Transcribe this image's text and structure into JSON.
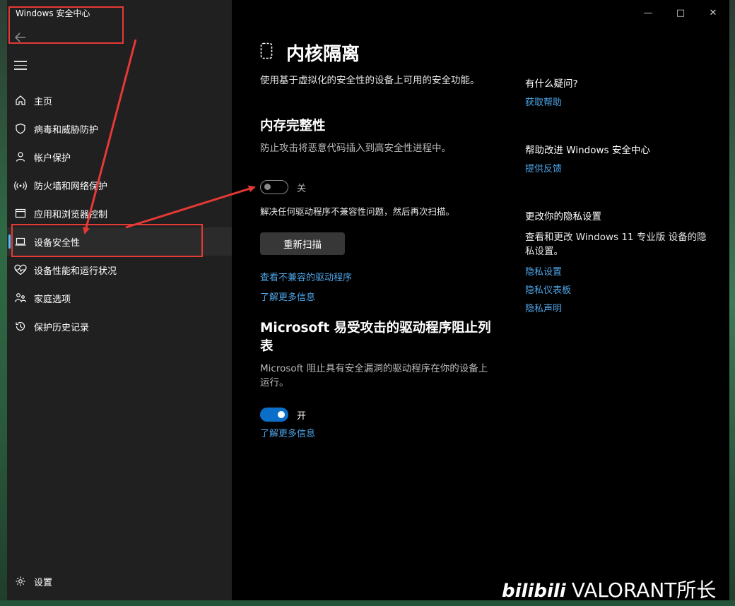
{
  "window": {
    "title": "Windows 安全中心",
    "minimize_glyph": "—",
    "maximize_glyph": "□",
    "close_glyph": "✕"
  },
  "sidebar": {
    "items": [
      {
        "label": "主页",
        "icon": "home-icon"
      },
      {
        "label": "病毒和威胁防护",
        "icon": "shield-icon"
      },
      {
        "label": "帐户保护",
        "icon": "person-icon"
      },
      {
        "label": "防火墙和网络保护",
        "icon": "wifi-icon"
      },
      {
        "label": "应用和浏览器控制",
        "icon": "app-window-icon"
      },
      {
        "label": "设备安全性",
        "icon": "laptop-icon",
        "active": true
      },
      {
        "label": "设备性能和运行状况",
        "icon": "heart-pulse-icon"
      },
      {
        "label": "家庭选项",
        "icon": "family-icon"
      },
      {
        "label": "保护历史记录",
        "icon": "history-icon"
      }
    ],
    "settings_label": "设置"
  },
  "main": {
    "title": "内核隔离",
    "description": "使用基于虚拟化的安全性的设备上可用的安全功能。",
    "memory_integrity": {
      "title": "内存完整性",
      "description": "防止攻击将恶意代码插入到高安全性进程中。",
      "toggle_state": "关",
      "warning": "解决任何驱动程序不兼容性问题，然后再次扫描。",
      "rescan_button": "重新扫描",
      "view_link": "查看不兼容的驱动程序",
      "learn_more": "了解更多信息"
    },
    "blocklist": {
      "title": "Microsoft 易受攻击的驱动程序阻止列表",
      "description": "Microsoft 阻止具有安全漏洞的驱动程序在你的设备上运行。",
      "toggle_state": "开",
      "learn_more": "了解更多信息"
    }
  },
  "aside": {
    "help_title": "有什么疑问?",
    "help_link": "获取帮助",
    "improve_title": "帮助改进 Windows 安全中心",
    "improve_link": "提供反馈",
    "privacy_title": "更改你的隐私设置",
    "privacy_text": "查看和更改 Windows 11 专业版 设备的隐私设置。",
    "privacy_links": [
      "隐私设置",
      "隐私仪表板",
      "隐私声明"
    ]
  },
  "watermark": {
    "logo": "bilibili",
    "text": "VALORANT所长"
  },
  "colors": {
    "accent": "#4cc2ff",
    "link": "#4ea6ea",
    "toggle_on": "#0a6fc9",
    "annotation": "#e53935"
  }
}
